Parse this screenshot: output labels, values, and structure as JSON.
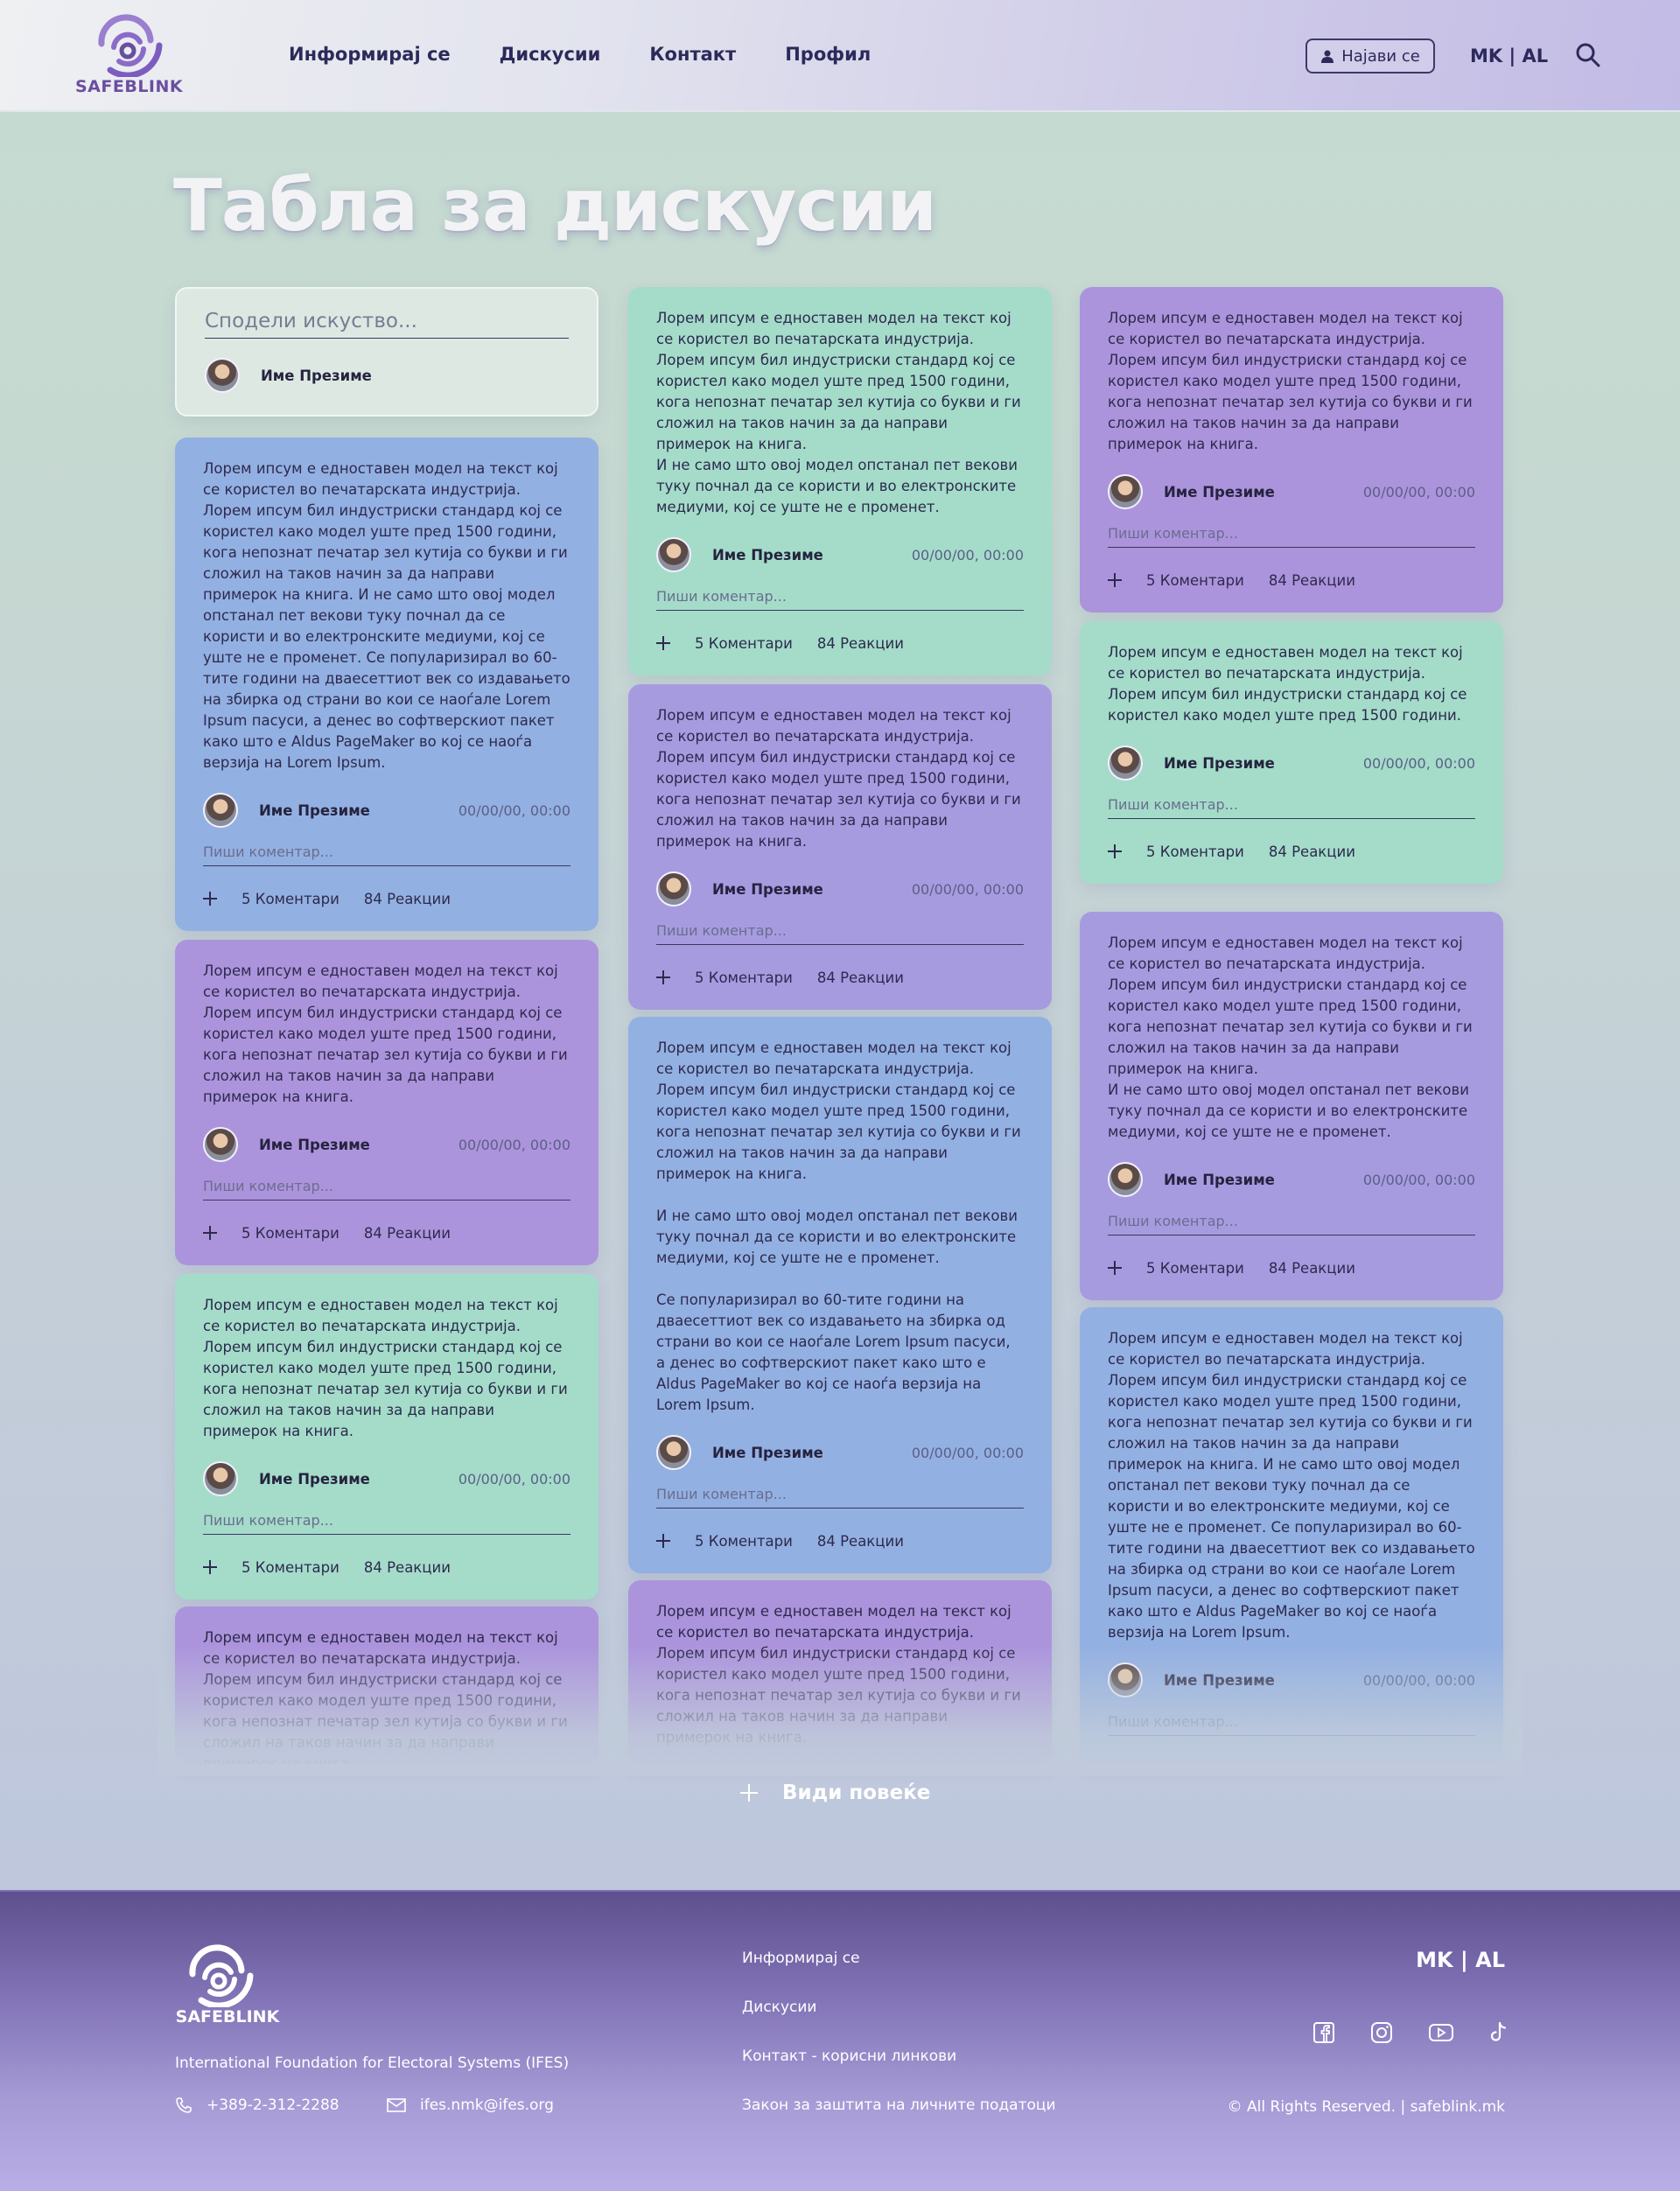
{
  "header": {
    "brand": "SAFEBLINK",
    "nav": [
      "Информирај се",
      "Дискусии",
      "Контакт",
      "Профил"
    ],
    "login_label": "Најави се",
    "lang": "MK | AL"
  },
  "page": {
    "title": "Табла за дискусии"
  },
  "share": {
    "placeholder": "Сподели искуство...",
    "author": "Име Презиме"
  },
  "post_meta": {
    "author": "Име Презиме",
    "date": "00/00/00, 00:00",
    "comment_placeholder": "Пиши коментар...",
    "comments": "5 Коментари",
    "reactions": "84 Реакции"
  },
  "posts": [
    "Лорем ипсум е едноставен модел на текст кој се користел во печатарската индустрија. Лорем ипсум бил индустриски стандард кој се користел како модел уште пред 1500 години, кога непознат печатар зел кутија со букви и ги сложил на таков начин за да направи примерок на книга. И не само што овој модел опстанал пет векови туку почнал да се користи и во електронските медиуми, кој се уште не е променет. Се популаризирал во 60-тите години на дваесеттиот век со издавањето на збирка од страни во кои се наоѓале Lorem Ipsum пасуси, а денес во софтверскиот пакет како што е Aldus PageMaker во кој се наоѓа верзија на Lorem Ipsum.",
    "Лорем ипсум е едноставен модел на текст кој се користел во печатарската индустрија. Лорем ипсум бил индустриски стандард кој се користел како модел уште пред 1500 години, кога непознат печатар зел кутија со букви и ги сложил на таков начин за да направи примерок на книга.",
    "Лорем ипсум е едноставен модел на текст кој се користел во печатарската индустрија. Лорем ипсум бил индустриски стандард кој се користел како модел уште пред 1500 години, кога непознат печатар зел кутија со букви и ги сложил на таков начин за да направи примерок на книга.\nИ не само што овој модел опстанал пет векови туку почнал да се користи и во електронските медиуми, кој се уште не е променет.",
    "Лорем ипсум е едноставен модел на текст кој се користел во печатарската индустрија. Лорем ипсум бил индустриски стандард кој се користел како модел уште пред 1500 години, кога непознат печатар зел кутија со букви и ги сложил на таков начин за да направи примерок на книга.\n\nИ не само што овој модел опстанал пет векови туку почнал да се користи и во електронските медиуми, кој се уште не е променет.\n\nСе популаризирал во 60-тите години на дваесеттиот век со издавањето на збирка од страни во кои се наоѓале Lorem Ipsum пасуси, а денес во софтверскиот пакет како што е Aldus PageMaker во кој се наоѓа верзија на Lorem Ipsum.",
    "Лорем ипсум е едноставен модел на текст кој се користел во печатарската индустрија. Лорем ипсум бил индустриски стандард кој се користел како модел уште пред 1500 години.",
    "Лорем ипсум е едноставен модел на текст кој се користел во печатарската индустрија. Лорем ипсум бил индустриски стандард кој се користел како модел уште пред 1500 години, кога непознат печатар зел кутија со букви и ги сложил на таков начин за да направи примерок на книга. И не само што овој модел опстанал пет векови туку почнал да се користи и во електронските медиуми, кој се уште не е променет. Се популаризирал во 60-тите години на дваесеттиот век со издавањето на збирка од страни во кои се наоѓале Lorem Ipsum пасуси, а денес во софтверскиот пакет како што е Aldus PageMaker во кој се наоѓа верзија на Lorem Ipsum."
  ],
  "see_more": "Види повеќе",
  "footer": {
    "brand": "SAFEBLINK",
    "org": "International Foundation for Electoral Systems (IFES)",
    "phone": "+389-2-312-2288",
    "email": "ifes.nmk@ifes.org",
    "links": [
      "Информирај се",
      "Дискусии",
      "Контакт - корисни линкови",
      "Закон за заштита на личните податоци"
    ],
    "lang": "MK | AL",
    "copyright": "© All Rights Reserved.  |  safeblink.mk",
    "social": [
      "facebook-icon",
      "instagram-icon",
      "youtube-icon",
      "tiktok-icon"
    ]
  },
  "colors": {
    "blue": "#93b0e2",
    "purple": "#ac94dc",
    "green": "#a4dcc9",
    "brand": "#6a4fa0"
  }
}
